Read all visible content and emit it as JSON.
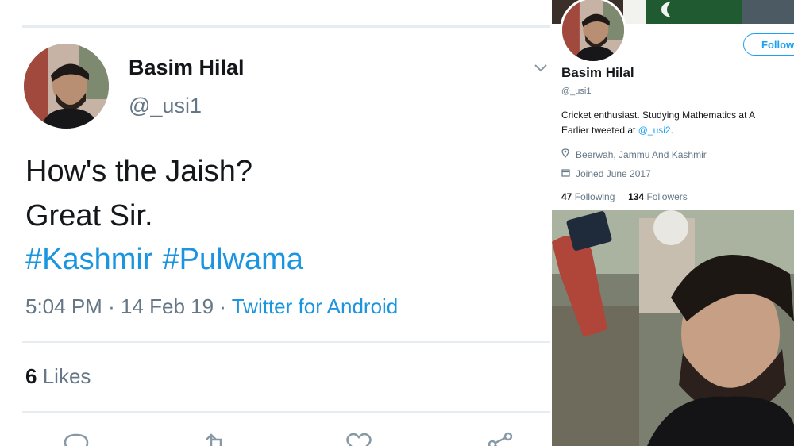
{
  "tweet": {
    "author_name": "Basim Hilal",
    "author_handle": "@_usi1",
    "text_line1": "How's the Jaish?",
    "text_line2": "Great Sir.",
    "hashtags": [
      "#Kashmir",
      "#Pulwama"
    ],
    "time": "5:04 PM",
    "date": "14 Feb 19",
    "source": "Twitter for Android",
    "separator": "·",
    "likes_count": "6",
    "likes_label": "Likes"
  },
  "profile": {
    "name": "Basim Hilal",
    "handle": "@_usi1",
    "follow_label": "Follow",
    "bio_line1": "Cricket enthusiast. Studying Mathematics at A",
    "bio_line2_prefix": "Earlier tweeted at ",
    "bio_line2_link": "@_usi2",
    "bio_line2_suffix": ".",
    "location": "Beerwah, Jammu And Kashmir",
    "joined": "Joined June 2017",
    "following_count": "47",
    "following_label": "Following",
    "followers_count": "134",
    "followers_label": "Followers"
  },
  "colors": {
    "link_blue": "#1b95e0",
    "secondary_gray": "#657786",
    "text_dark": "#14171a"
  },
  "icons": {
    "location": "pin-icon",
    "joined": "calendar-icon",
    "chevron": "chevron-down-icon"
  }
}
